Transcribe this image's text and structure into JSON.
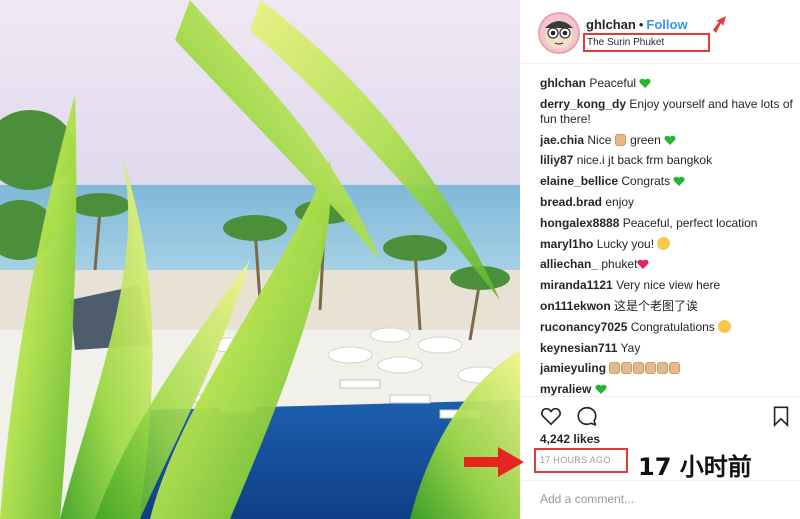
{
  "post": {
    "username": "ghlchan",
    "separator": "•",
    "follow_label": "Follow",
    "location": "The Surin Phuket"
  },
  "comments": [
    {
      "user": "ghlchan",
      "text": "Peaceful ",
      "emoji": "green-heart"
    },
    {
      "user": "derry_kong_dy",
      "text": "Enjoy yourself and have lots of fun there!"
    },
    {
      "user": "jae.chia",
      "text": "Nice ",
      "emoji_seq": [
        "thumbs-up",
        "green-text",
        "green-heart"
      ],
      "extra": "green"
    },
    {
      "user": "liliy87",
      "text": "nice.i jt back frm bangkok"
    },
    {
      "user": "elaine_bellice",
      "text": "Congrats ",
      "emoji": "green-heart"
    },
    {
      "user": "bread.brad",
      "text": "enjoy"
    },
    {
      "user": "hongalex8888",
      "text": "Peaceful, perfect location"
    },
    {
      "user": "maryl1ho",
      "text": "Lucky you! ",
      "emoji": "sunglasses-face"
    },
    {
      "user": "alliechan_",
      "text": "phuket",
      "emoji": "red-heart"
    },
    {
      "user": "miranda1121",
      "text": "Very nice view here"
    },
    {
      "user": "on111ekwon",
      "text": "这是个老图了诶"
    },
    {
      "user": "ruconancy7025",
      "text": "Congratulations ",
      "emoji": "smiling-face"
    },
    {
      "user": "keynesian711",
      "text": "Yay"
    },
    {
      "user": "jamieyuling",
      "text": "",
      "emoji": "thumbs-up-x6"
    },
    {
      "user": "myraliew",
      "text": "",
      "emoji": "green-heart"
    }
  ],
  "likes": "4,242 likes",
  "timestamp": "17 HOURS AGO",
  "timestamp_annotation": "17 小时前",
  "add_comment_placeholder": "Add a comment...",
  "colors": {
    "follow": "#3897f0",
    "annotation_red": "#e23b3b",
    "green_heart": "#27b52d"
  },
  "icons": {
    "like": "heart-outline-icon",
    "comment": "speech-bubble-icon",
    "save": "bookmark-icon"
  }
}
